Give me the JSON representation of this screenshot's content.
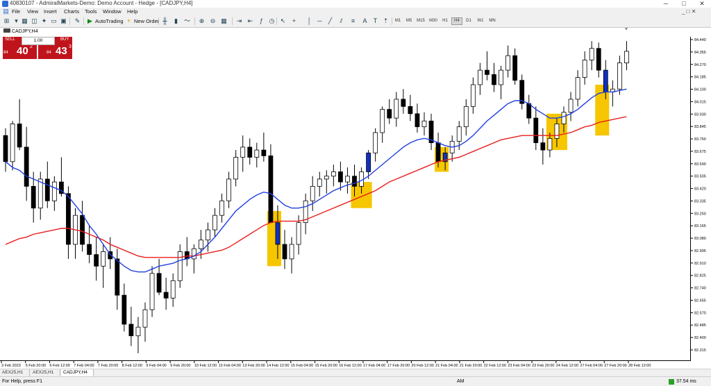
{
  "titlebar": {
    "title": "40830107 - AdmiralMarkets-Demo: Demo Account - Hedge - [CADJPY,H4]",
    "minimize": "─",
    "maximize": "□",
    "close": "✕"
  },
  "menu": {
    "items": [
      "File",
      "View",
      "Insert",
      "Charts",
      "Tools",
      "Window",
      "Help"
    ],
    "mdi_controls": "_  □  ✕"
  },
  "toolbar": {
    "autotrading": "AutoTrading",
    "new_order": "New Order",
    "timeframes": [
      "M1",
      "M5",
      "M15",
      "M30",
      "H1",
      "H4",
      "D1",
      "W1",
      "MN"
    ],
    "active_timeframe": "H4"
  },
  "chart": {
    "symbol_label": "CADJPY,H4",
    "trade_panel": {
      "sell_label": "SELL",
      "buy_label": "BUY",
      "lot": "1.00",
      "sell_prefix": "84",
      "sell_big": "40",
      "sell_sup": "2",
      "buy_prefix": "84",
      "buy_big": "43",
      "buy_sup": "3"
    }
  },
  "tabs": [
    "AEX25,H1",
    "AEX25,H1",
    "CADJPY,H4"
  ],
  "active_tab": 2,
  "statusbar": {
    "help": "For Help, press F1",
    "profile": "AM",
    "connection": "37.54 ms"
  },
  "colors": {
    "bull": "#ffffff",
    "bear": "#000000",
    "ma_fast": "#1f3fe0",
    "ma_slow": "#e81c1c",
    "highlight": "#f6c600",
    "sell_btn": "#c0141c",
    "highlight_candle": "#1030c0"
  },
  "chart_data": {
    "type": "candlestick",
    "price_axis_labels": [
      "84.440",
      "84.355",
      "84.270",
      "84.185",
      "84.100",
      "84.015",
      "83.930",
      "83.845",
      "83.760",
      "83.675",
      "83.590",
      "83.505",
      "83.420",
      "83.335",
      "83.250",
      "83.165",
      "83.080",
      "82.995",
      "82.910",
      "82.825",
      "82.740",
      "82.655",
      "82.570",
      "82.485",
      "82.400",
      "82.315"
    ],
    "time_axis_labels": [
      "3 Feb 2023",
      "5 Feb 20:00",
      "6 Feb 12:00",
      "7 Feb 04:00",
      "7 Feb 20:00",
      "8 Feb 12:00",
      "9 Feb 04:00",
      "9 Feb 20:00",
      "10 Feb 12:00",
      "13 Feb 04:00",
      "13 Feb 20:00",
      "14 Feb 12:00",
      "15 Feb 04:00",
      "15 Feb 20:00",
      "16 Feb 12:00",
      "17 Feb 04:00",
      "17 Feb 20:00",
      "20 Feb 12:00",
      "21 Feb 04:00",
      "21 Feb 20:00",
      "22 Feb 12:00",
      "23 Feb 04:00",
      "23 Feb 20:00",
      "24 Feb 12:00",
      "27 Feb 04:00",
      "27 Feb 20:00",
      "28 Feb 12:00"
    ],
    "ylim": [
      82.28,
      84.48
    ],
    "candles": [
      [
        83.8,
        83.85,
        83.55,
        83.62
      ],
      [
        83.62,
        83.9,
        83.56,
        83.88
      ],
      [
        83.88,
        84.05,
        83.7,
        83.72
      ],
      [
        83.72,
        83.86,
        83.35,
        83.45
      ],
      [
        83.45,
        83.55,
        83.2,
        83.3
      ],
      [
        83.3,
        83.55,
        83.22,
        83.5
      ],
      [
        83.5,
        83.62,
        83.3,
        83.35
      ],
      [
        83.35,
        83.52,
        83.28,
        83.48
      ],
      [
        83.48,
        83.65,
        83.38,
        83.4
      ],
      [
        83.4,
        83.45,
        82.95,
        83.05
      ],
      [
        83.05,
        83.3,
        82.95,
        83.25
      ],
      [
        83.25,
        83.35,
        83.0,
        83.05
      ],
      [
        83.05,
        83.18,
        82.92,
        82.98
      ],
      [
        82.98,
        83.1,
        82.8,
        82.9
      ],
      [
        82.9,
        83.05,
        82.75,
        83.0
      ],
      [
        83.0,
        83.1,
        82.88,
        82.95
      ],
      [
        82.95,
        83.02,
        82.6,
        82.7
      ],
      [
        82.7,
        82.78,
        82.45,
        82.5
      ],
      [
        82.5,
        82.62,
        82.35,
        82.42
      ],
      [
        82.42,
        82.55,
        82.3,
        82.48
      ],
      [
        82.48,
        82.65,
        82.38,
        82.6
      ],
      [
        82.6,
        82.9,
        82.55,
        82.85
      ],
      [
        82.85,
        82.95,
        82.7,
        82.72
      ],
      [
        82.72,
        82.82,
        82.6,
        82.68
      ],
      [
        82.68,
        82.85,
        82.62,
        82.8
      ],
      [
        82.8,
        83.05,
        82.75,
        83.0
      ],
      [
        83.0,
        83.1,
        82.9,
        82.95
      ],
      [
        82.95,
        83.05,
        82.85,
        83.02
      ],
      [
        83.02,
        83.15,
        82.95,
        83.08
      ],
      [
        83.08,
        83.2,
        83.0,
        83.15
      ],
      [
        83.15,
        83.3,
        83.1,
        83.25
      ],
      [
        83.25,
        83.4,
        83.2,
        83.35
      ],
      [
        83.35,
        83.55,
        83.3,
        83.5
      ],
      [
        83.5,
        83.7,
        83.45,
        83.65
      ],
      [
        83.65,
        83.8,
        83.55,
        83.72
      ],
      [
        83.72,
        83.78,
        83.6,
        83.65
      ],
      [
        83.65,
        83.75,
        83.58,
        83.7
      ],
      [
        83.7,
        83.82,
        83.62,
        83.66
      ],
      [
        83.66,
        83.74,
        83.5,
        83.2
      ],
      [
        83.2,
        83.32,
        82.95,
        83.05
      ],
      [
        83.05,
        83.15,
        82.88,
        82.95
      ],
      [
        82.95,
        83.1,
        82.85,
        83.05
      ],
      [
        83.05,
        83.25,
        82.98,
        83.2
      ],
      [
        83.2,
        83.4,
        83.12,
        83.35
      ],
      [
        83.35,
        83.52,
        83.28,
        83.45
      ],
      [
        83.45,
        83.55,
        83.38,
        83.5
      ],
      [
        83.5,
        83.56,
        83.4,
        83.52
      ],
      [
        83.52,
        83.6,
        83.45,
        83.55
      ],
      [
        83.55,
        83.62,
        83.42,
        83.48
      ],
      [
        83.48,
        83.58,
        83.4,
        83.52
      ],
      [
        83.52,
        83.6,
        83.38,
        83.45
      ],
      [
        83.45,
        83.58,
        83.4,
        83.55
      ],
      [
        83.55,
        83.7,
        83.5,
        83.68
      ],
      [
        83.68,
        83.85,
        83.62,
        83.82
      ],
      [
        83.82,
        84.0,
        83.75,
        83.98
      ],
      [
        83.98,
        84.05,
        83.88,
        83.92
      ],
      [
        83.92,
        84.1,
        83.86,
        84.05
      ],
      [
        84.05,
        84.12,
        83.95,
        84.0
      ],
      [
        84.0,
        84.08,
        83.9,
        83.95
      ],
      [
        83.95,
        84.02,
        83.82,
        83.86
      ],
      [
        83.86,
        83.96,
        83.8,
        83.9
      ],
      [
        83.9,
        83.95,
        83.7,
        83.75
      ],
      [
        83.75,
        83.82,
        83.58,
        83.62
      ],
      [
        83.62,
        83.72,
        83.56,
        83.68
      ],
      [
        83.68,
        83.8,
        83.62,
        83.76
      ],
      [
        83.76,
        83.9,
        83.7,
        83.86
      ],
      [
        83.86,
        84.05,
        83.8,
        84.0
      ],
      [
        84.0,
        84.2,
        83.95,
        84.15
      ],
      [
        84.15,
        84.3,
        84.08,
        84.25
      ],
      [
        84.25,
        84.38,
        84.18,
        84.22
      ],
      [
        84.22,
        84.3,
        84.1,
        84.15
      ],
      [
        84.15,
        84.28,
        84.05,
        84.25
      ],
      [
        84.25,
        84.42,
        84.2,
        84.35
      ],
      [
        84.35,
        84.4,
        84.15,
        84.18
      ],
      [
        84.18,
        84.22,
        83.98,
        84.02
      ],
      [
        84.02,
        84.08,
        83.88,
        83.92
      ],
      [
        83.92,
        84.0,
        83.7,
        83.75
      ],
      [
        83.75,
        83.85,
        83.6,
        83.7
      ],
      [
        83.7,
        83.82,
        83.65,
        83.78
      ],
      [
        83.78,
        83.92,
        83.72,
        83.88
      ],
      [
        83.88,
        84.0,
        83.82,
        83.96
      ],
      [
        83.96,
        84.1,
        83.9,
        84.05
      ],
      [
        84.05,
        84.25,
        84.0,
        84.2
      ],
      [
        84.2,
        84.38,
        84.15,
        84.32
      ],
      [
        84.32,
        84.45,
        84.25,
        84.4
      ],
      [
        84.4,
        84.44,
        84.2,
        84.25
      ],
      [
        84.25,
        84.32,
        84.05,
        84.1
      ],
      [
        84.1,
        84.18,
        84.0,
        84.12
      ],
      [
        84.12,
        84.35,
        84.08,
        84.3
      ],
      [
        84.3,
        84.45,
        84.25,
        84.38
      ]
    ],
    "ma_fast": [
      83.62,
      83.58,
      83.56,
      83.52,
      83.5,
      83.48,
      83.46,
      83.44,
      83.42,
      83.38,
      83.32,
      83.26,
      83.18,
      83.12,
      83.05,
      82.98,
      82.94,
      82.9,
      82.87,
      82.86,
      82.86,
      82.88,
      82.9,
      82.91,
      82.92,
      82.94,
      82.95,
      82.97,
      83.0,
      83.05,
      83.1,
      83.16,
      83.22,
      83.28,
      83.32,
      83.36,
      83.39,
      83.41,
      83.4,
      83.36,
      83.32,
      83.3,
      83.3,
      83.31,
      83.33,
      83.36,
      83.39,
      83.42,
      83.44,
      83.46,
      83.47,
      83.49,
      83.52,
      83.56,
      83.6,
      83.64,
      83.68,
      83.72,
      83.75,
      83.77,
      83.78,
      83.77,
      83.75,
      83.73,
      83.72,
      83.73,
      83.76,
      83.8,
      83.85,
      83.9,
      83.94,
      83.98,
      84.02,
      84.04,
      84.04,
      84.02,
      83.98,
      83.95,
      83.92,
      83.92,
      83.93,
      83.95,
      83.98,
      84.02,
      84.06,
      84.09,
      84.1,
      84.1,
      84.11,
      84.12
    ],
    "ma_slow": [
      83.05,
      83.07,
      83.09,
      83.1,
      83.12,
      83.13,
      83.14,
      83.15,
      83.16,
      83.16,
      83.15,
      83.14,
      83.12,
      83.1,
      83.08,
      83.05,
      83.03,
      83.01,
      82.99,
      82.97,
      82.96,
      82.96,
      82.96,
      82.96,
      82.96,
      82.96,
      82.97,
      82.97,
      82.98,
      82.99,
      83.0,
      83.01,
      83.03,
      83.06,
      83.09,
      83.12,
      83.15,
      83.18,
      83.2,
      83.21,
      83.21,
      83.21,
      83.21,
      83.22,
      83.24,
      83.26,
      83.28,
      83.3,
      83.32,
      83.34,
      83.36,
      83.38,
      83.4,
      83.42,
      83.45,
      83.48,
      83.5,
      83.52,
      83.54,
      83.56,
      83.58,
      83.6,
      83.62,
      83.63,
      83.64,
      83.65,
      83.67,
      83.69,
      83.71,
      83.73,
      83.75,
      83.77,
      83.78,
      83.79,
      83.8,
      83.8,
      83.8,
      83.8,
      83.8,
      83.8,
      83.81,
      83.82,
      83.84,
      83.86,
      83.87,
      83.89,
      83.9,
      83.91,
      83.92,
      83.93
    ],
    "highlighted_candles": [
      39,
      52,
      63,
      86
    ],
    "highlight_zones": [
      {
        "from": 38,
        "to": 39,
        "y": [
          82.9,
          83.28
        ]
      },
      {
        "from": 50,
        "to": 52,
        "y": [
          83.3,
          83.48
        ]
      },
      {
        "from": 62,
        "to": 63,
        "y": [
          83.55,
          83.72
        ]
      },
      {
        "from": 78,
        "to": 80,
        "y": [
          83.7,
          83.95
        ]
      },
      {
        "from": 85,
        "to": 86,
        "y": [
          83.8,
          84.15
        ]
      }
    ]
  }
}
